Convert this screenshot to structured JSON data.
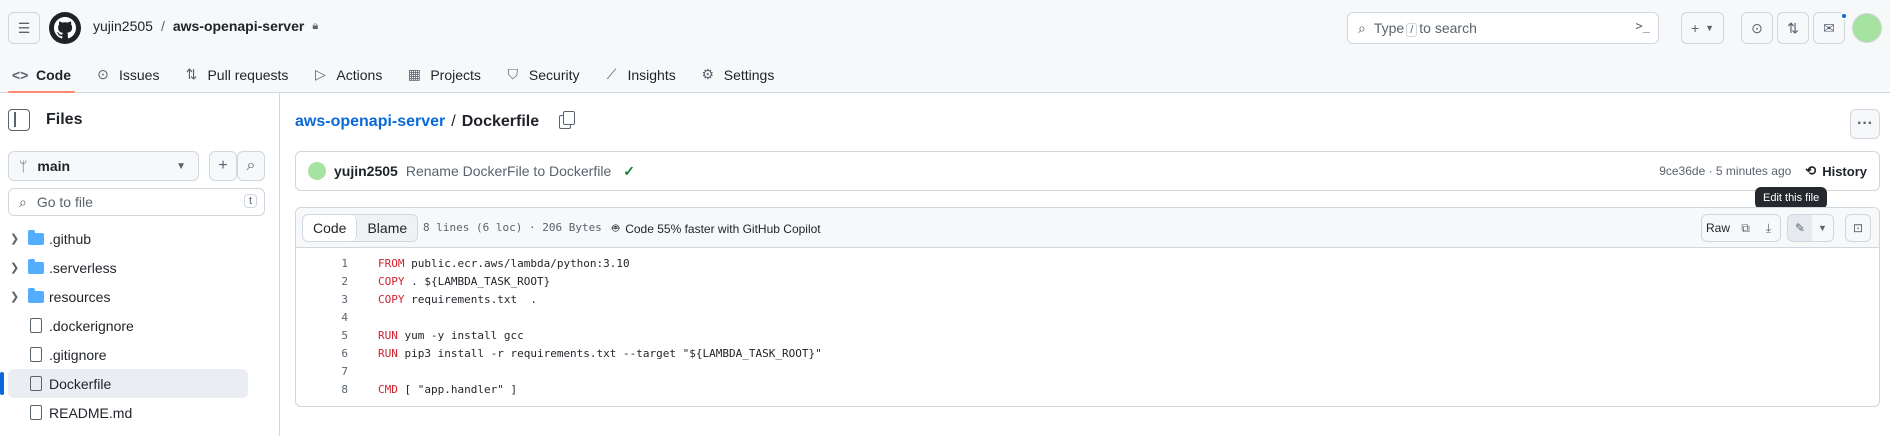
{
  "topbar": {
    "owner": "yujin2505",
    "separator": "/",
    "repo": "aws-openapi-server",
    "search_pre": "Type",
    "search_key": "/",
    "search_post": "to search",
    "cmd_label": ">_"
  },
  "tabs": [
    {
      "label": "Code",
      "icon": "code-icon"
    },
    {
      "label": "Issues",
      "icon": "issue-icon"
    },
    {
      "label": "Pull requests",
      "icon": "pull-request-icon"
    },
    {
      "label": "Actions",
      "icon": "play-icon"
    },
    {
      "label": "Projects",
      "icon": "table-icon"
    },
    {
      "label": "Security",
      "icon": "shield-icon"
    },
    {
      "label": "Insights",
      "icon": "graph-icon"
    },
    {
      "label": "Settings",
      "icon": "gear-icon"
    }
  ],
  "sidebar": {
    "title": "Files",
    "branch": "main",
    "goto_placeholder": "Go to file",
    "goto_key": "t",
    "items": [
      {
        "label": ".github",
        "type": "folder"
      },
      {
        "label": ".serverless",
        "type": "folder"
      },
      {
        "label": "resources",
        "type": "folder"
      },
      {
        "label": ".dockerignore",
        "type": "file"
      },
      {
        "label": ".gitignore",
        "type": "file"
      },
      {
        "label": "Dockerfile",
        "type": "file"
      },
      {
        "label": "README.md",
        "type": "file"
      }
    ]
  },
  "main": {
    "repo_link": "aws-openapi-server",
    "path_sep": "/",
    "file_name": "Dockerfile",
    "commit": {
      "user": "yujin2505",
      "message": "Rename DockerFile to Dockerfile",
      "check": "✓",
      "hash_time": "9ce36de · 5 minutes ago",
      "history": "History"
    },
    "tooltip": "Edit this file",
    "toolbar": {
      "code_tab": "Code",
      "blame_tab": "Blame",
      "info": "8 lines (6 loc) · 206 Bytes",
      "copilot": "Code 55% faster with GitHub Copilot",
      "raw": "Raw"
    },
    "lines": [
      {
        "n": "1",
        "kw": "FROM",
        "rest": " public.ecr.aws/lambda/python:3.10"
      },
      {
        "n": "2",
        "kw": "COPY",
        "rest": " . ${LAMBDA_TASK_ROOT}"
      },
      {
        "n": "3",
        "kw": "COPY",
        "rest": " requirements.txt  ."
      },
      {
        "n": "4",
        "kw": "",
        "rest": ""
      },
      {
        "n": "5",
        "kw": "RUN",
        "rest": " yum -y install gcc"
      },
      {
        "n": "6",
        "kw": "RUN",
        "rest": " pip3 install -r requirements.txt --target \"${LAMBDA_TASK_ROOT}\""
      },
      {
        "n": "7",
        "kw": "",
        "rest": ""
      },
      {
        "n": "8",
        "kw": "CMD",
        "rest": " [ \"app.handler\" ]"
      }
    ]
  },
  "colors": {
    "accent": "#0969da",
    "tab_underline": "#fd8c73",
    "keyword": "#cf222e",
    "success": "#1a7f37"
  }
}
